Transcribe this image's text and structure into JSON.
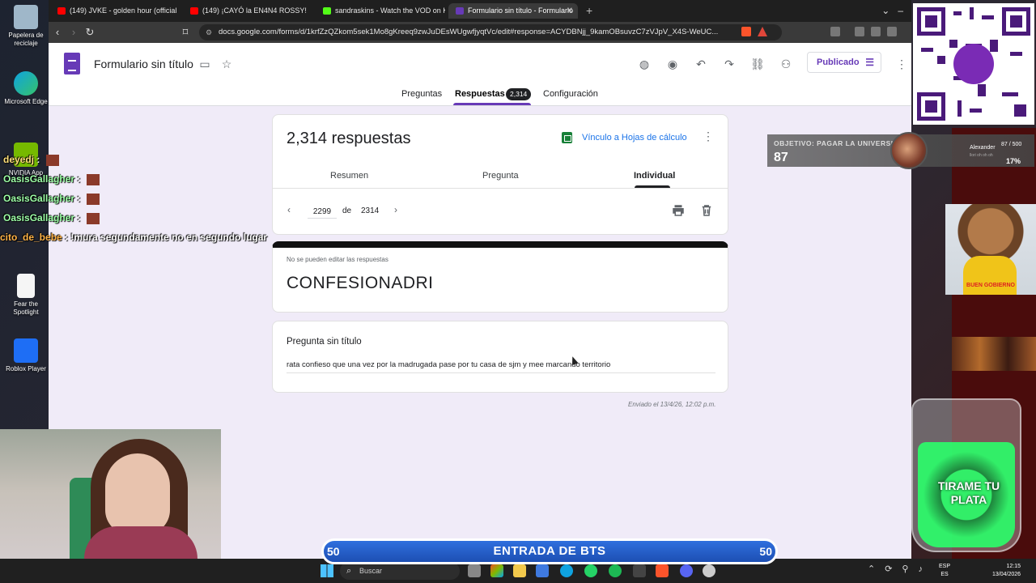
{
  "desktop": {
    "icons": [
      {
        "label": "Papelera de reciclaje"
      },
      {
        "label": "Microsoft Edge"
      },
      {
        "label": "NVIDIA App"
      },
      {
        "label": "Fear the Spotlight"
      },
      {
        "label": "Roblox Player"
      }
    ]
  },
  "browser": {
    "tabs": [
      {
        "title": "(149) JVKE - golden hour (official",
        "color": "#ff0000"
      },
      {
        "title": "(149) ¡CAYÓ la EN4N4 ROSSY!",
        "color": "#ff0000"
      },
      {
        "title": "sandraskins - Watch the VOD on Kick",
        "color": "#53fc18"
      },
      {
        "title": "Formulario sin título - Formulario",
        "color": "#673ab7"
      }
    ],
    "url": "docs.google.com/forms/d/1krfZzQZkom5sek1Mo8gKreeq9zwJuDEsWUgwfjyqtVc/edit#response=ACYDBNjj_9kamOBsuvzC7zVJpV_X4S-WeUC..."
  },
  "form": {
    "title": "Formulario sin título",
    "publish_label": "Publicado",
    "tabs": {
      "questions": "Preguntas",
      "responses": "Respuestas",
      "settings": "Configuración"
    },
    "response_badge": "2,314",
    "accent": "#673ab7"
  },
  "responses": {
    "count_label": "2,314 respuestas",
    "sheets_link": "Vínculo a Hojas de cálculo",
    "subtabs": {
      "summary": "Resumen",
      "question": "Pregunta",
      "individual": "Individual"
    },
    "current": "2299",
    "of_label": "de",
    "total": "2314"
  },
  "response_card": {
    "notice": "No se pueden editar las respuestas",
    "form_name": "CONFESIONADRI",
    "question_title": "Pregunta sin título",
    "answer": "rata confieso que una vez por la madrugada pase por tu casa de sjm y mee marcando territorio",
    "submitted": "Enviado el 13/4/26, 12:02 p.m."
  },
  "overlay": {
    "goal": {
      "label": "OBJETIVO: PAGAR LA UNIVERSIDAD",
      "value": "87",
      "name": "Alexander",
      "progress": "87 / 500",
      "sub": "llori oh oh oh",
      "percent": "17%"
    },
    "dog_caption": "BUEN GOBIERNO",
    "jar_text": "TIRAME TU PLATA",
    "banner": {
      "left": "50",
      "title": "ENTRADA DE BTS",
      "right": "50"
    },
    "chat": [
      {
        "user": "deyedj",
        "message": ""
      },
      {
        "user": "OasisGallagher",
        "message": ""
      },
      {
        "user": "OasisGallagher",
        "message": ""
      },
      {
        "user": "OasisGallagher",
        "message": ""
      },
      {
        "user": "cito_de_bebe",
        "message": "!mura segundamente no en segundo lugar"
      }
    ]
  },
  "taskbar": {
    "search_placeholder": "Buscar",
    "lang_top": "ESP",
    "lang_bottom": "ES",
    "time": "12:15",
    "date": "13/04/2026"
  }
}
